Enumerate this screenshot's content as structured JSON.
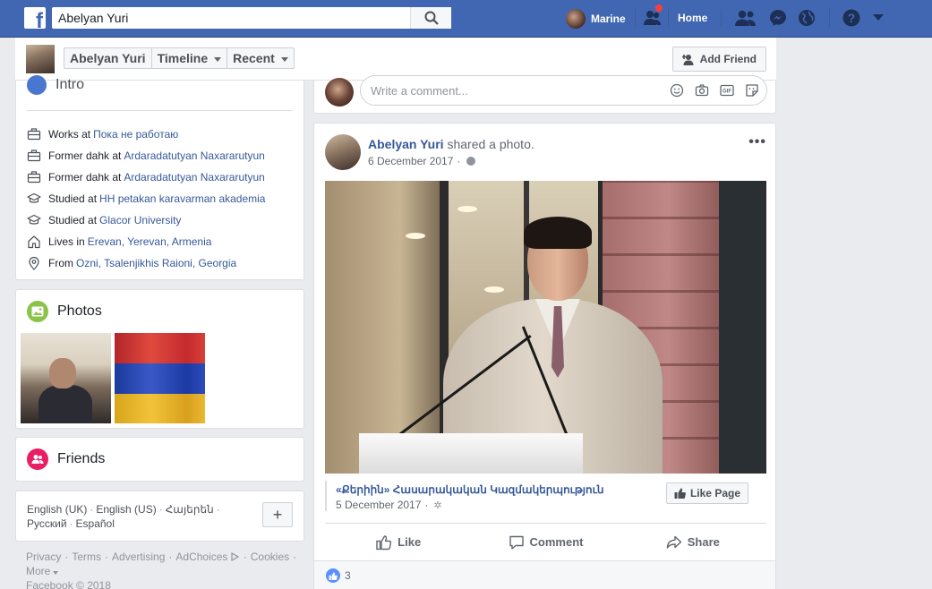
{
  "topbar": {
    "logo": "f",
    "search_value": "Abelyan Yuri",
    "user_name": "Marine",
    "home_label": "Home",
    "icons": [
      "search-icon",
      "friend-requests-icon",
      "messenger-icon",
      "globe-icon",
      "help-icon",
      "chevron-down-icon"
    ],
    "notification_color": "#fa3e3e",
    "brand_color": "#4267b2"
  },
  "profile_bar": {
    "name": "Abelyan Yuri",
    "tabs": [
      {
        "label": "Abelyan Yuri",
        "has_caret": false
      },
      {
        "label": "Timeline",
        "has_caret": true
      },
      {
        "label": "Recent",
        "has_caret": true
      }
    ],
    "add_friend_label": "Add Friend"
  },
  "intro": {
    "title": "Intro",
    "items": [
      {
        "icon": "briefcase-icon",
        "pre": "Works at",
        "link": "Пока не работаю"
      },
      {
        "icon": "briefcase-icon",
        "pre": "Former dahk at",
        "link": "Ardaradatutyan Naxararutyun"
      },
      {
        "icon": "briefcase-icon",
        "pre": "Former dahk at",
        "link": "Ardaradatutyan Naxararutyun"
      },
      {
        "icon": "graduation-cap-icon",
        "pre": "Studied at",
        "link": "HH petakan karavarman akademia"
      },
      {
        "icon": "graduation-cap-icon",
        "pre": "Studied at",
        "link": "Glacor University"
      },
      {
        "icon": "home-icon",
        "pre": "Lives in",
        "link": "Erevan, Yerevan, Armenia"
      },
      {
        "icon": "location-pin-icon",
        "pre": "From",
        "link": "Ozni, Tsalenjikhis Raioni, Georgia"
      }
    ]
  },
  "photos": {
    "title": "Photos",
    "icon_color": "#8bc34a"
  },
  "friends": {
    "title": "Friends",
    "icon_color": "#e91e63"
  },
  "languages": {
    "items": [
      "English (UK)",
      "English (US)",
      "Հայերեն",
      "Русский",
      "Español"
    ],
    "plus_label": "+"
  },
  "footer": {
    "links": [
      "Privacy",
      "Terms",
      "Advertising",
      "AdChoices",
      "Cookies"
    ],
    "more_label": "More",
    "copyright": "Facebook © 2018"
  },
  "comment_box": {
    "placeholder": "Write a comment...",
    "icons": [
      "emoji-icon",
      "camera-icon",
      "gif-icon",
      "sticker-icon"
    ]
  },
  "post": {
    "author": "Abelyan Yuri",
    "action_text": "shared a photo.",
    "date": "6 December 2017",
    "separator": "·",
    "more_label": "•••",
    "shared_page": {
      "title": "«Քերիին» Հասարակական Կազմակերպություն",
      "date": "5 December 2017",
      "like_page_label": "Like Page"
    },
    "actions": [
      {
        "label": "Like",
        "icon": "thumbs-up-icon"
      },
      {
        "label": "Comment",
        "icon": "comment-icon"
      },
      {
        "label": "Share",
        "icon": "share-icon"
      }
    ],
    "reaction_count": "3"
  }
}
